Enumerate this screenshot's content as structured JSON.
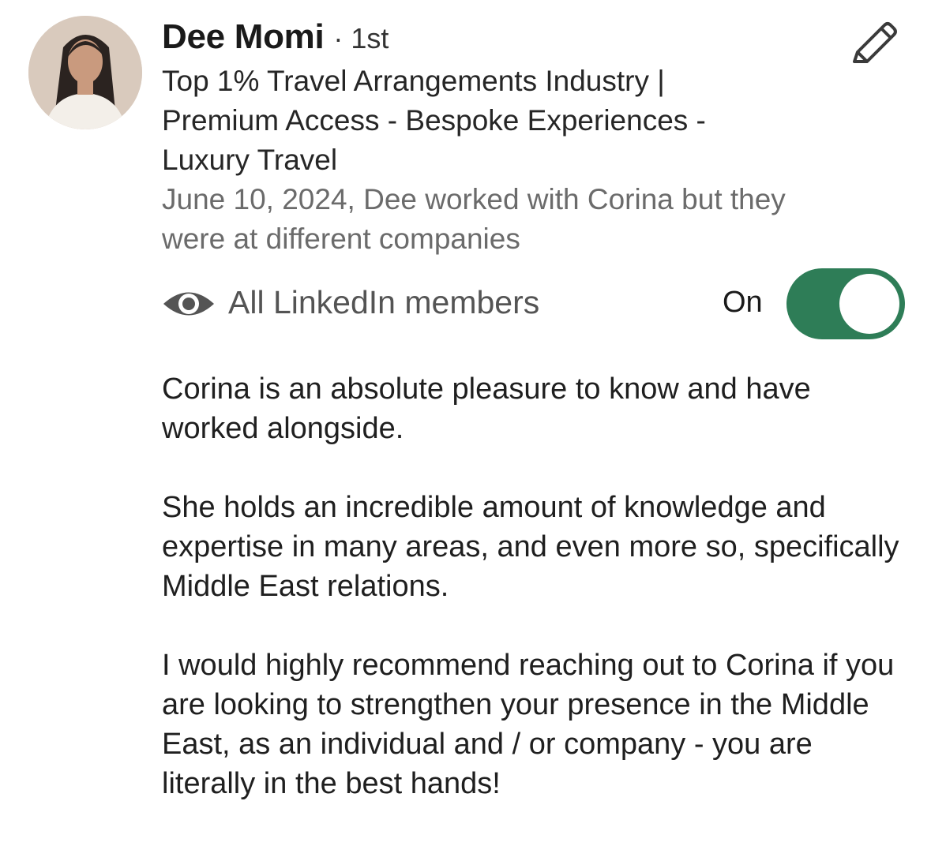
{
  "recommender": {
    "name": "Dee Momi",
    "degree": "· 1st",
    "headline": "Top 1% Travel Arrangements Industry | Premium Access - Bespoke Experiences - Luxury Travel",
    "meta": "June 10, 2024, Dee worked with Corina but they were at different companies"
  },
  "visibility": {
    "icon": "eye-icon",
    "label": "All LinkedIn members",
    "toggle_label": "On",
    "toggle_on": true,
    "toggle_color": "#2e7d57"
  },
  "recommendation": {
    "paragraphs": [
      "Corina is an absolute pleasure to know and have worked alongside.",
      "She holds an incredible amount of knowledge and expertise in many areas, and even more so, specifically Middle East relations.",
      "I would highly recommend reaching out to Corina if you are looking to strengthen your presence in the Middle East, as an individual and / or company - you are literally in the best hands!"
    ]
  },
  "actions": {
    "edit_icon": "pencil-icon"
  }
}
